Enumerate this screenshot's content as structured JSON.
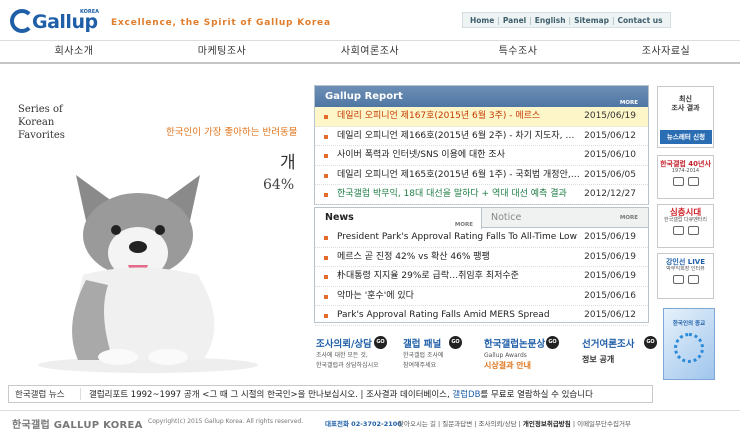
{
  "header": {
    "logo": "Gallup",
    "logo_sup": "KOREA",
    "tagline": "Excellence, the Spirit of Gallup Korea",
    "topnav": [
      "Home",
      "Panel",
      "English",
      "Sitemap",
      "Contact us"
    ]
  },
  "mainnav": [
    "회사소개",
    "마케팅조사",
    "사회여론조사",
    "특수조사",
    "조사자료실"
  ],
  "hero": {
    "series": [
      "Series of",
      "Korean",
      "Favorites"
    ],
    "caption": "한국인이 가장 좋아하는 반려동물",
    "word": "개",
    "percent": "64%"
  },
  "report": {
    "title": "Gallup Report",
    "more": "MORE",
    "items": [
      {
        "title": "데일리 오피니언 제167호(2015년 6월 3주) - 메르스",
        "date": "2015/06/19"
      },
      {
        "title": "데일리 오피니언 제166호(2015년 6월 2주) - 차기 지도자, 총…",
        "date": "2015/06/12"
      },
      {
        "title": "사이버 폭력과 인터넷/SNS 이용에 대한 조사",
        "date": "2015/06/10"
      },
      {
        "title": "데일리 오피니언 제165호(2015년 6월 1주) - 국회법 개정안,…",
        "date": "2015/06/05"
      },
      {
        "title": "한국갤럽 박무익, 18대 대선을 말하다 + 역대 대선 예측 결과",
        "date": "2012/12/27"
      }
    ]
  },
  "news": {
    "tab1": "News",
    "tab2": "Notice",
    "more": "MORE",
    "items": [
      {
        "title": "President Park's Approval Rating Falls To All-Time Low",
        "date": "2015/06/19"
      },
      {
        "title": "메르스 곧 진정 42% vs 확산 46% 팽팽",
        "date": "2015/06/19"
      },
      {
        "title": "朴대통령 지지율 29%로 급락…취임후 최저수준",
        "date": "2015/06/19"
      },
      {
        "title": "악마는 '훈수'에 있다",
        "date": "2015/06/16"
      },
      {
        "title": "Park's Approval Rating Falls Amid MERS Spread",
        "date": "2015/06/12"
      }
    ]
  },
  "quicklinks": [
    {
      "title": "조사의뢰/상담",
      "sub": [
        "조사에 대한 모든 것,",
        "한국갤럽과 상담하십시오"
      ],
      "go": "GO"
    },
    {
      "title": "갤럽 패널",
      "sub": [
        "한국갤럽 조사에",
        "참여해주세요"
      ],
      "go": "GO"
    },
    {
      "title": "한국갤럽논문상",
      "title2": "Gallup Awards",
      "sub2": "시상결과 안내",
      "go": "GO"
    },
    {
      "title": "선거여론조사",
      "sub2": "정보 공개",
      "go": "GO"
    }
  ],
  "right": {
    "box1": {
      "line1": "최신",
      "line2": "조사 결과",
      "btn": "뉴스레터 신청"
    },
    "box2": {
      "a": "한국갤럽 40년사",
      "b": "1974-2014"
    },
    "box3": {
      "a": "심층시대",
      "b": "한국갤럽 다큐멘터리"
    },
    "box4": {
      "a": "강인선 LIVE",
      "b": "박무익회장 인터뷰"
    },
    "book": "한국인의 종교"
  },
  "ticker": {
    "label": "한국갤럽 뉴스",
    "text_a": "갤럽리포트 1992~1997 공개 <그 때 그 시절의 한국인>을 만나보십시오.  |  조사결과 데이터베이스, ",
    "text_hl": "갤럽DB",
    "text_b": "를 무료로 열람하실 수 있습니다"
  },
  "footer": {
    "logo": "한국갤럽  GALLUP KOREA",
    "copyright": "Copyright(c) 2015 Gallup Korea. All rights reserved.",
    "tel": "대표전화 02-3702-2100",
    "links": [
      "찾아오시는 길",
      "질문과답변",
      "조사의뢰/상담",
      "개인정보취급방침",
      "이메일무단수집거부"
    ]
  }
}
